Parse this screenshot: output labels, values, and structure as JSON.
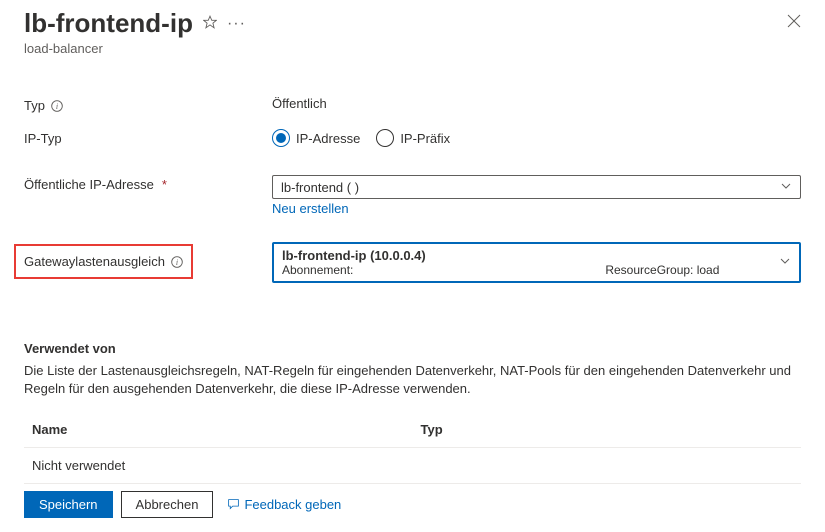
{
  "header": {
    "title": "lb-frontend-ip",
    "subtitle": "load-balancer"
  },
  "form": {
    "typ_label": "Typ",
    "typ_value": "Öffentlich",
    "iptyp_label": "IP-Typ",
    "iptyp_options": {
      "adresse": "IP-Adresse",
      "prefix": "IP-Präfix"
    },
    "pubip_label": "Öffentliche IP-Adresse",
    "pubip_value": "lb-frontend (                            )",
    "neu_erstellen": "Neu erstellen",
    "gw_label": "Gatewaylastenausgleich",
    "gw_value_top": "lb-frontend-ip (10.0.0.4)",
    "gw_value_sub_left": "Abonnement:",
    "gw_value_sub_right": "ResourceGroup: load"
  },
  "used": {
    "heading": "Verwendet von",
    "desc": "Die Liste der Lastenausgleichsregeln, NAT-Regeln für eingehenden Datenverkehr, NAT-Pools für den eingehenden Datenverkehr und Regeln für den ausgehenden Datenverkehr, die diese IP-Adresse verwenden.",
    "col_name": "Name",
    "col_typ": "Typ",
    "empty": "Nicht verwendet"
  },
  "footer": {
    "save": "Speichern",
    "cancel": "Abbrechen",
    "feedback": "Feedback geben"
  }
}
